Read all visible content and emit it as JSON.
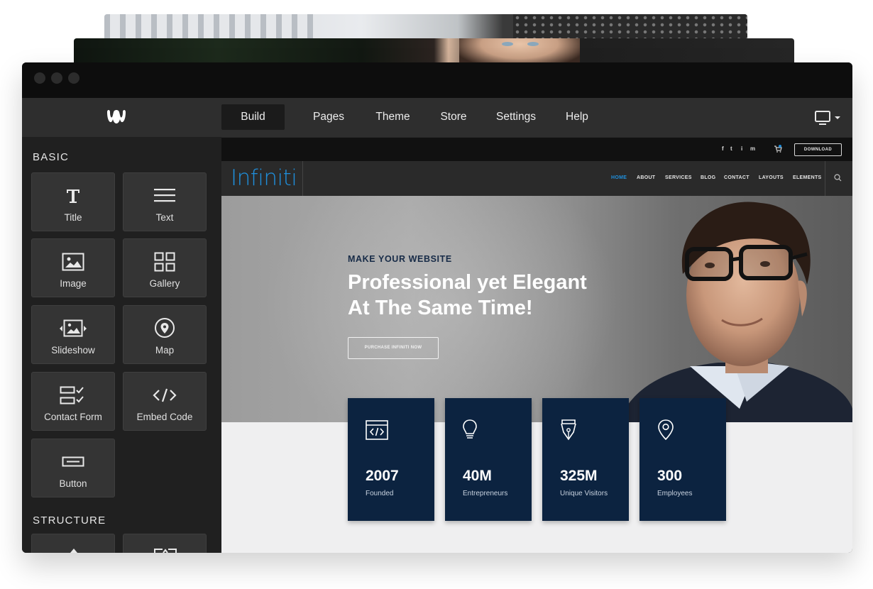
{
  "app": {
    "brand_icon": "weebly-w-logo",
    "nav": [
      {
        "label": "Build",
        "active": true
      },
      {
        "label": "Pages"
      },
      {
        "label": "Theme"
      },
      {
        "label": "Store"
      },
      {
        "label": "Settings"
      },
      {
        "label": "Help"
      }
    ],
    "device_icon": "desktop-monitor-icon"
  },
  "sidebar": {
    "basic_title": "BASIC",
    "structure_title": "STRUCTURE",
    "items": [
      {
        "label": "Title",
        "icon": "title-icon"
      },
      {
        "label": "Text",
        "icon": "text-icon"
      },
      {
        "label": "Image",
        "icon": "image-icon"
      },
      {
        "label": "Gallery",
        "icon": "gallery-icon"
      },
      {
        "label": "Slideshow",
        "icon": "slideshow-icon"
      },
      {
        "label": "Map",
        "icon": "map-pin-icon"
      },
      {
        "label": "Contact Form",
        "icon": "contact-form-icon"
      },
      {
        "label": "Embed Code",
        "icon": "embed-code-icon"
      },
      {
        "label": "Button",
        "icon": "button-icon"
      }
    ]
  },
  "site": {
    "topbar": {
      "social": [
        "f",
        "t",
        "i",
        "m"
      ],
      "cart_icon": "cart-icon",
      "download_label": "DOWNLOAD"
    },
    "logo": "Infiniti",
    "nav": [
      {
        "label": "HOME",
        "active": true
      },
      {
        "label": "ABOUT"
      },
      {
        "label": "SERVICES"
      },
      {
        "label": "BLOG"
      },
      {
        "label": "CONTACT"
      },
      {
        "label": "LAYOUTS"
      },
      {
        "label": "ELEMENTS"
      }
    ],
    "hero": {
      "kicker": "MAKE YOUR WEBSITE",
      "headline_line1": "Professional yet Elegant",
      "headline_line2": "At The Same Time!",
      "cta": "PURCHASE INFINITI NOW"
    },
    "stats": [
      {
        "value": "2007",
        "label": "Founded",
        "icon": "code-window-icon"
      },
      {
        "value": "40M",
        "label": "Entrepreneurs",
        "icon": "lightbulb-icon"
      },
      {
        "value": "325M",
        "label": "Unique Visitors",
        "icon": "pen-nib-icon"
      },
      {
        "value": "300",
        "label": "Employees",
        "icon": "location-pin-icon"
      }
    ]
  },
  "colors": {
    "accent_blue": "#1f8fdc",
    "stat_card": "#0c2340",
    "kicker": "#172b47"
  }
}
